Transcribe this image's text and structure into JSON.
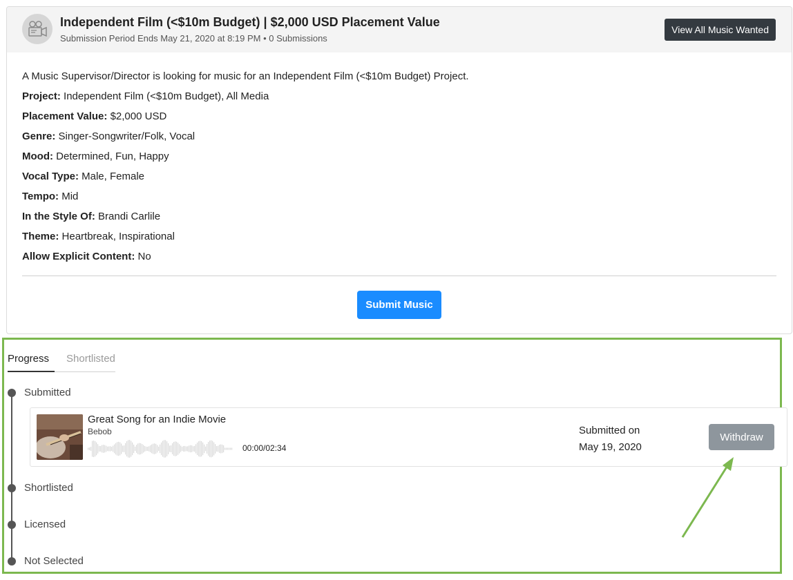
{
  "header": {
    "title": "Independent Film (<$10m Budget) | $2,000 USD Placement Value",
    "subtitle": "Submission Period Ends May 21, 2020 at 8:19 PM • 0 Submissions",
    "view_all_label": "View All Music Wanted",
    "icon": "film-camera-icon"
  },
  "description": {
    "intro": "A Music Supervisor/Director is looking for music for an Independent Film (<$10m Budget) Project.",
    "details": [
      {
        "key": "Project:",
        "value": "Independent Film (<$10m Budget), All Media"
      },
      {
        "key": "Placement Value:",
        "value": "$2,000 USD"
      },
      {
        "key": "Genre:",
        "value": "Singer-Songwriter/Folk, Vocal"
      },
      {
        "key": "Mood:",
        "value": "Determined, Fun, Happy"
      },
      {
        "key": "Vocal Type:",
        "value": "Male, Female"
      },
      {
        "key": "Tempo:",
        "value": "Mid"
      },
      {
        "key": "In the Style Of:",
        "value": "Brandi Carlile"
      },
      {
        "key": "Theme:",
        "value": "Heartbreak, Inspirational"
      },
      {
        "key": "Allow Explicit Content:",
        "value": "No"
      }
    ]
  },
  "submit_label": "Submit Music",
  "tabs": [
    {
      "label": "Progress",
      "active": true
    },
    {
      "label": "Shortlisted",
      "active": false
    }
  ],
  "stages": [
    "Submitted",
    "Shortlisted",
    "Licensed",
    "Not Selected"
  ],
  "submission": {
    "title": "Great Song for an Indie Movie",
    "artist": "Bebob",
    "time": "00:00/02:34",
    "submitted_label": "Submitted on",
    "submitted_date": "May 19, 2020",
    "withdraw_label": "Withdraw"
  },
  "colors": {
    "highlight": "#7cb84f",
    "primary": "#1a8cff",
    "dark_button": "#343a40",
    "muted_button": "#8e969d"
  }
}
